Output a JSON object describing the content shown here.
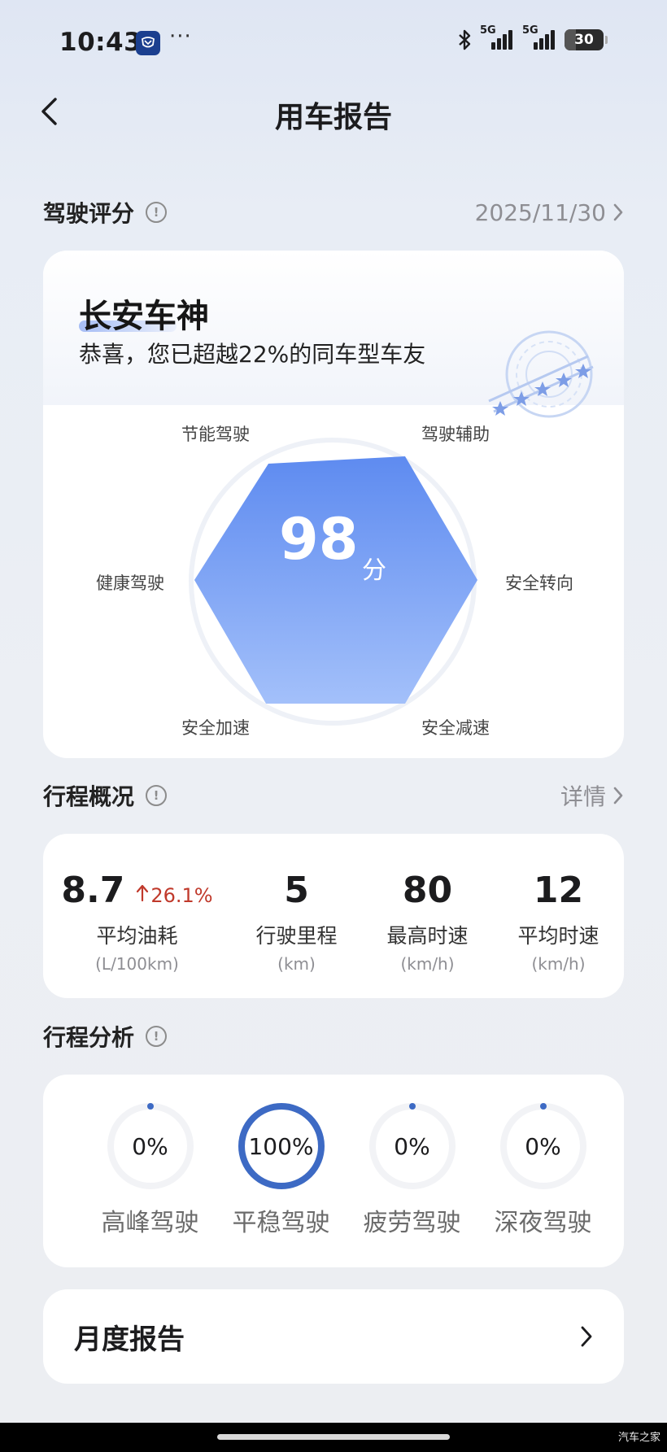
{
  "status_bar": {
    "time": "10:43",
    "more": "···",
    "network_1": "5G",
    "network_2": "5G",
    "battery": "30",
    "battery_level": 0.3
  },
  "header": {
    "title": "用车报告"
  },
  "driving_score": {
    "section_title": "驾驶评分",
    "date": "2025/11/30",
    "rank_title": "长安车神",
    "rank_subtitle": "恭喜，您已超越22%的同车型车友",
    "score": "98",
    "score_unit": "分",
    "dimensions": [
      "节能驾驶",
      "驾驶辅助",
      "安全转向",
      "安全减速",
      "安全加速",
      "健康驾驶"
    ]
  },
  "trip_overview": {
    "section_title": "行程概况",
    "link": "详情",
    "stats": [
      {
        "value": "8.7",
        "change": "26.1%",
        "label": "平均油耗",
        "unit": "(L/100km)"
      },
      {
        "value": "5",
        "label": "行驶里程",
        "unit": "(km)"
      },
      {
        "value": "80",
        "label": "最高时速",
        "unit": "(km/h)"
      },
      {
        "value": "12",
        "label": "平均时速",
        "unit": "(km/h)"
      }
    ]
  },
  "trip_analysis": {
    "section_title": "行程分析",
    "items": [
      {
        "text": "0%",
        "label": "高峰驾驶",
        "percent": 0
      },
      {
        "text": "100%",
        "label": "平稳驾驶",
        "percent": 100
      },
      {
        "text": "0%",
        "label": "疲劳驾驶",
        "percent": 0
      },
      {
        "text": "0%",
        "label": "深夜驾驶",
        "percent": 0
      }
    ]
  },
  "monthly_report": {
    "title": "月度报告"
  },
  "watermark": "汽车之家",
  "colors": {
    "accent": "#3d6ac4",
    "radar_top": "#5e8bf0",
    "radar_bottom": "#a3c0fa",
    "increase": "#c0392b"
  }
}
